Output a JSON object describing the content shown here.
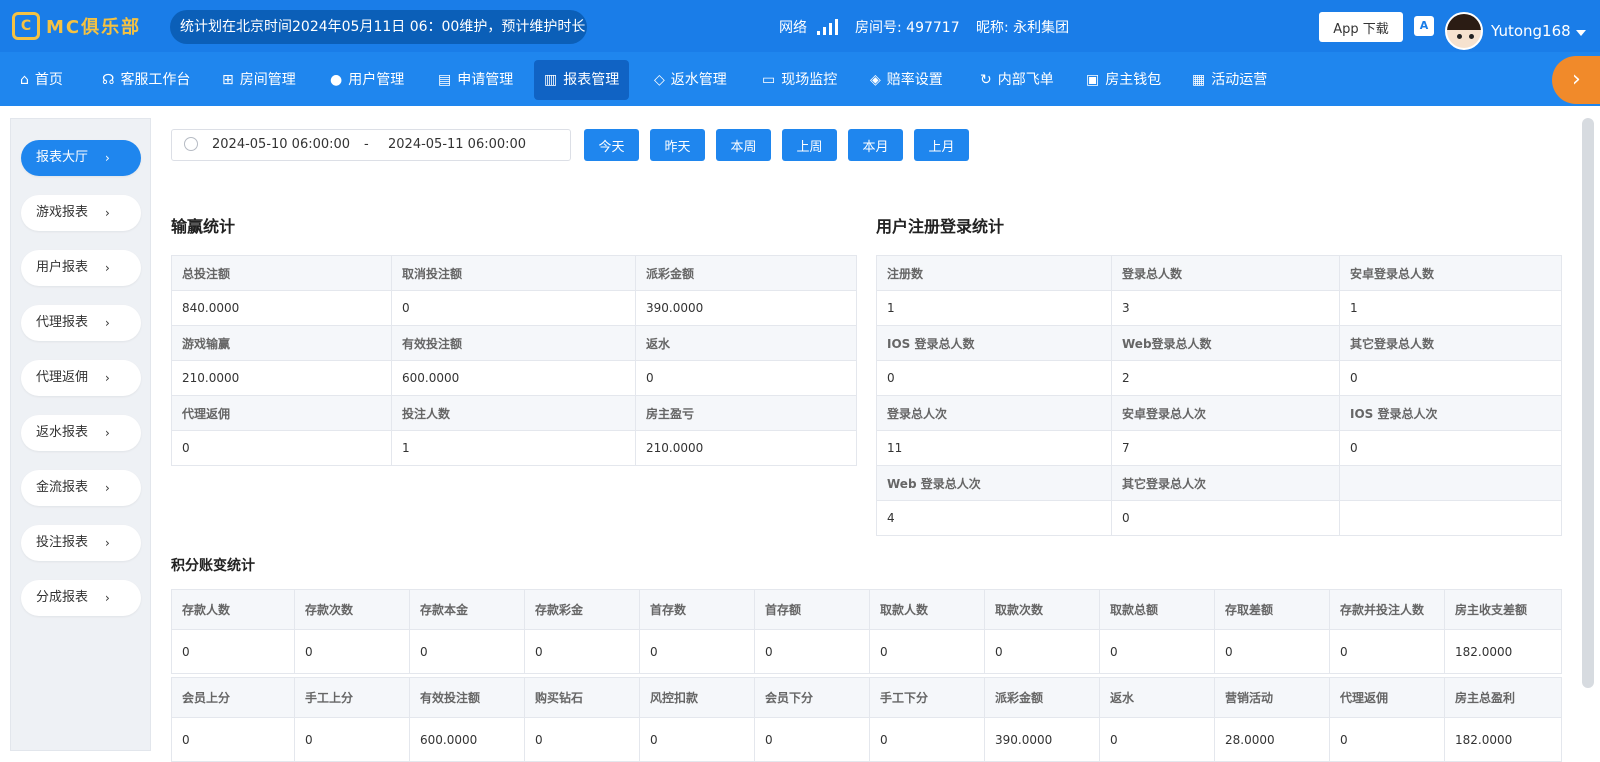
{
  "header": {
    "logo_mark": "C",
    "logo_text": "MC俱乐部",
    "marquee": "统计划在北京时间2024年05月11日 06：00维护，预计维护时长",
    "network_label": "网络",
    "room": "房间号: 497717",
    "nickname": "昵称: 永利集团",
    "app_download": "App 下载",
    "lang_icon": "A",
    "username": "Yutong168"
  },
  "nav": {
    "items": [
      {
        "label": "首页",
        "icon": "home-icon",
        "glyph": "⌂"
      },
      {
        "label": "客服工作台",
        "icon": "headset-icon",
        "glyph": "☊"
      },
      {
        "label": "房间管理",
        "icon": "grid-icon",
        "glyph": "⊞"
      },
      {
        "label": "用户管理",
        "icon": "user-icon",
        "glyph": "●"
      },
      {
        "label": "申请管理",
        "icon": "document-icon",
        "glyph": "▤"
      },
      {
        "label": "报表管理",
        "icon": "bar-chart-icon",
        "glyph": "▥"
      },
      {
        "label": "返水管理",
        "icon": "tag-icon",
        "glyph": "◇"
      },
      {
        "label": "现场监控",
        "icon": "monitor-icon",
        "glyph": "▭"
      },
      {
        "label": "赔率设置",
        "icon": "shield-icon",
        "glyph": "◈"
      },
      {
        "label": "内部飞单",
        "icon": "refresh-icon",
        "glyph": "↻"
      },
      {
        "label": "房主钱包",
        "icon": "wallet-icon",
        "glyph": "▣"
      },
      {
        "label": "活动运营",
        "icon": "clipboard-icon",
        "glyph": "▦"
      }
    ],
    "active_index": 5,
    "more_glyph": "›"
  },
  "sidebar": {
    "items": [
      "报表大厅",
      "游戏报表",
      "用户报表",
      "代理报表",
      "代理返佣",
      "返水报表",
      "金流报表",
      "投注报表",
      "分成报表"
    ],
    "active_index": 0,
    "chevron": "›"
  },
  "filter": {
    "start": "2024-05-10 06:00:00",
    "separator": "-",
    "end": "2024-05-11 06:00:00",
    "quick": [
      "今天",
      "昨天",
      "本周",
      "上周",
      "本月",
      "上月"
    ]
  },
  "winloss": {
    "title": "输赢统计",
    "rows": [
      {
        "headers": [
          "总投注额",
          "取消投注额",
          "派彩金额"
        ],
        "values": [
          "840.0000",
          "0",
          "390.0000"
        ]
      },
      {
        "headers": [
          "游戏输赢",
          "有效投注额",
          "返水"
        ],
        "values": [
          "210.0000",
          "600.0000",
          "0"
        ]
      },
      {
        "headers": [
          "代理返佣",
          "投注人数",
          "房主盈亏"
        ],
        "values": [
          "0",
          "1",
          "210.0000"
        ]
      }
    ]
  },
  "register": {
    "title": "用户注册登录统计",
    "rows": [
      {
        "headers": [
          "注册数",
          "登录总人数",
          "安卓登录总人数"
        ],
        "values": [
          "1",
          "3",
          "1"
        ]
      },
      {
        "headers": [
          "IOS 登录总人数",
          "Web登录总人数",
          "其它登录总人数"
        ],
        "values": [
          "0",
          "2",
          "0"
        ]
      },
      {
        "headers": [
          "登录总人次",
          "安卓登录总人次",
          "IOS 登录总人次"
        ],
        "values": [
          "11",
          "7",
          "0"
        ]
      },
      {
        "headers": [
          "Web 登录总人次",
          "其它登录总人次",
          ""
        ],
        "values": [
          "4",
          "0",
          ""
        ]
      }
    ]
  },
  "points": {
    "title": "积分账变统计",
    "rows": [
      {
        "headers": [
          "存款人数",
          "存款次数",
          "存款本金",
          "存款彩金",
          "首存数",
          "首存额",
          "取款人数",
          "取款次数",
          "取款总额",
          "存取差额",
          "存款并投注人数",
          "房主收支差额"
        ],
        "values": [
          "0",
          "0",
          "0",
          "0",
          "0",
          "0",
          "0",
          "0",
          "0",
          "0",
          "0",
          "182.0000"
        ]
      },
      {
        "headers": [
          "会员上分",
          "手工上分",
          "有效投注额",
          "购买钻石",
          "风控扣款",
          "会员下分",
          "手工下分",
          "派彩金额",
          "返水",
          "营销活动",
          "代理返佣",
          "房主总盈利"
        ],
        "values": [
          "0",
          "0",
          "600.0000",
          "0",
          "0",
          "0",
          "0",
          "390.0000",
          "0",
          "28.0000",
          "0",
          "182.0000"
        ]
      }
    ]
  }
}
